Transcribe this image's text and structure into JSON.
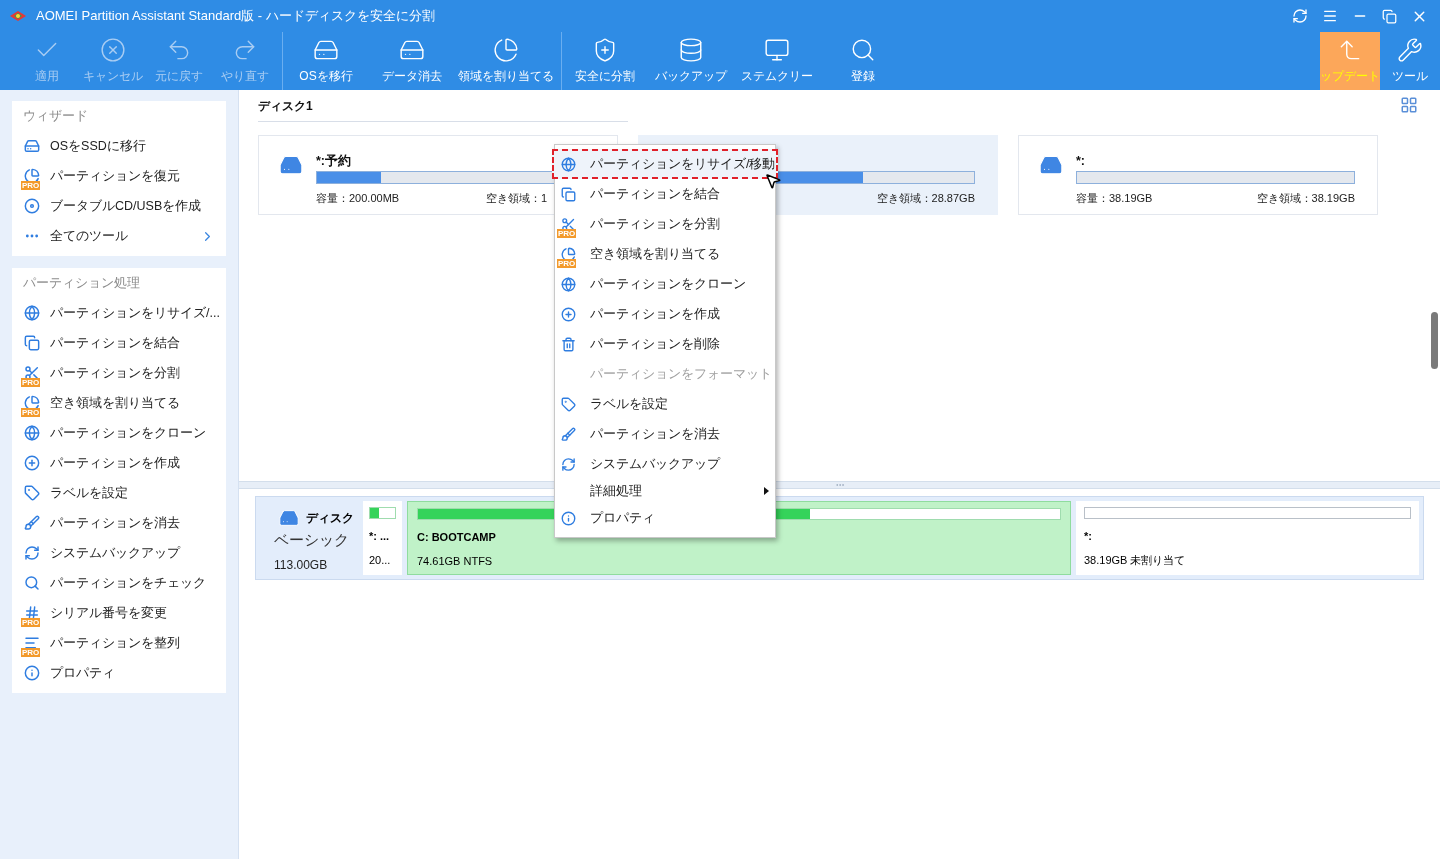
{
  "window": {
    "title": "AOMEI Partition Assistant Standard版 - ハードディスクを安全に分割"
  },
  "toolbar": {
    "groups": [
      [
        {
          "label": "適用",
          "disabled": true
        },
        {
          "label": "キャンセル",
          "disabled": true
        },
        {
          "label": "元に戻す",
          "disabled": true
        },
        {
          "label": "やり直す",
          "disabled": true
        }
      ],
      [
        {
          "label": "OSを移行",
          "disabled": false
        },
        {
          "label": "データ消去",
          "disabled": false
        },
        {
          "label": "領域を割り当てる",
          "disabled": false
        }
      ],
      [
        {
          "label": "安全に分割",
          "disabled": false
        },
        {
          "label": "バックアップ",
          "disabled": false
        },
        {
          "label": "ステムクリー",
          "disabled": false
        },
        {
          "label": "登録",
          "disabled": false
        }
      ]
    ],
    "right": [
      {
        "label": "ップデート",
        "highlighted": true
      },
      {
        "label": "ツール",
        "highlighted": false
      }
    ]
  },
  "sidebar": {
    "sections": [
      {
        "title": "ウィザード",
        "items": [
          {
            "label": "OSをSSDに移行",
            "kind": "tool"
          },
          {
            "label": "パーティションを復元",
            "kind": "tool",
            "badge": "PRO"
          },
          {
            "label": "ブータブルCD/USBを作成",
            "kind": "tool"
          },
          {
            "label": "全てのツール",
            "kind": "expand"
          }
        ]
      },
      {
        "title": "パーティション処理",
        "items": [
          {
            "label": "パーティションをリサイズ/...",
            "kind": "tool"
          },
          {
            "label": "パーティションを結合",
            "kind": "tool"
          },
          {
            "label": "パーティションを分割",
            "kind": "tool",
            "badge": "PRO"
          },
          {
            "label": "空き領域を割り当てる",
            "kind": "tool",
            "badge": "PRO"
          },
          {
            "label": "パーティションをクローン",
            "kind": "tool"
          },
          {
            "label": "パーティションを作成",
            "kind": "tool"
          },
          {
            "label": "ラベルを設定",
            "kind": "tool"
          },
          {
            "label": "パーティションを消去",
            "kind": "tool"
          },
          {
            "label": "システムバックアップ",
            "kind": "tool"
          },
          {
            "label": "パーティションをチェック",
            "kind": "tool"
          },
          {
            "label": "シリアル番号を変更",
            "kind": "tool",
            "badge": "PRO"
          },
          {
            "label": "パーティションを整列",
            "kind": "tool",
            "badge": "PRO"
          },
          {
            "label": "プロパティ",
            "kind": "tool"
          }
        ]
      }
    ]
  },
  "disk_map": {
    "heading": "ディスク1",
    "partitions": [
      {
        "name": "*:予約",
        "level": 0.23,
        "capacity": "容量：200.00MB",
        "free": "空き領域：1",
        "selected": false
      },
      {
        "level": 0.6,
        "free": "空き領域：28.87GB",
        "selected": true
      },
      {
        "name": "*:",
        "capacity": "容量：38.19GB",
        "free": "空き領域：38.19GB",
        "selected": false
      }
    ]
  },
  "disk_row": {
    "name": "ディスク",
    "type": "ベーシック",
    "size": "113.00GB",
    "partitions": [
      {
        "kind": "small",
        "label": "*: ...",
        "detail": "20...",
        "level": 0.35
      },
      {
        "kind": "primary",
        "label": "C: BOOTCAMP",
        "detail": "74.61GB NTFS",
        "level": 0.61
      },
      {
        "kind": "unallocated",
        "label": "*:",
        "detail": "38.19GB 未割り当て"
      }
    ]
  },
  "context_menu": {
    "items": [
      {
        "label": "パーティションをリサイズ/移動",
        "kind": "item",
        "disabled": false,
        "highlighted": true
      },
      {
        "label": "パーティションを結合",
        "kind": "item",
        "disabled": false,
        "highlighted": false
      },
      {
        "label": "パーティションを分割",
        "kind": "item",
        "disabled": false,
        "highlighted": false,
        "badge": "PRO"
      },
      {
        "label": "空き領域を割り当てる",
        "kind": "item",
        "disabled": false,
        "highlighted": false,
        "badge": "PRO"
      },
      {
        "label": "パーティションをクローン",
        "kind": "item",
        "disabled": false,
        "highlighted": false
      },
      {
        "label": "パーティションを作成",
        "kind": "item",
        "disabled": false,
        "highlighted": false
      },
      {
        "label": "パーティションを削除",
        "kind": "item",
        "disabled": false,
        "highlighted": false
      },
      {
        "label": "パーティションをフォーマット",
        "kind": "item",
        "disabled": true,
        "highlighted": false
      },
      {
        "label": "ラベルを設定",
        "kind": "item",
        "disabled": false,
        "highlighted": false
      },
      {
        "label": "パーティションを消去",
        "kind": "item",
        "disabled": false,
        "highlighted": false
      },
      {
        "label": "システムバックアップ",
        "kind": "item",
        "disabled": false,
        "highlighted": false
      },
      {
        "label": "詳細処理",
        "kind": "submenu",
        "disabled": false,
        "highlighted": false
      },
      {
        "label": "プロパティ",
        "kind": "item",
        "disabled": false,
        "highlighted": false
      }
    ]
  }
}
